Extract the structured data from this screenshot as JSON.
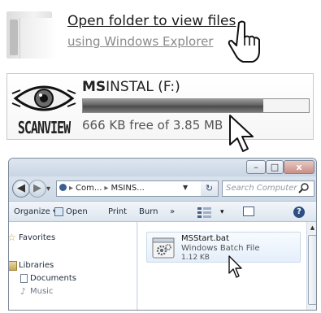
{
  "autoplay_option": {
    "title": "Open folder to view files",
    "subtitle": "using Windows Explorer"
  },
  "drive": {
    "logo_text": "SCANVIEW",
    "label_bold": "MS",
    "label_rest": "INSTAL (F:)",
    "free_text": "666 KB free of 3.85 MB",
    "used_fraction": 0.8
  },
  "window": {
    "controls": {
      "minimize": "–",
      "maximize": "□",
      "close": "x"
    },
    "address": {
      "segments": [
        "Com...",
        "MSINS..."
      ],
      "back": "◀",
      "forward": "▶"
    },
    "refresh_symbol": "↻",
    "search_placeholder": "Search Computer",
    "toolbar": {
      "organize": "Organize ▾",
      "open": "Open",
      "print": "Print",
      "burn": "Burn",
      "more": "»",
      "views_caret": "▾",
      "help": "?"
    },
    "nav": {
      "favorites": "Favorites",
      "libraries": "Libraries",
      "documents": "Documents",
      "music": "Music"
    },
    "file": {
      "name": "MSStart.bat",
      "type": "Windows Batch File",
      "size": "1.12 KB"
    },
    "scroll_up": "▲"
  }
}
